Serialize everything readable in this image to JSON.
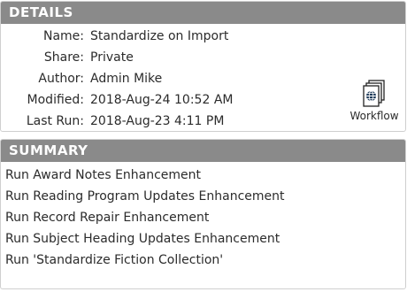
{
  "details": {
    "title": "DETAILS",
    "fields": [
      {
        "label": "Name:",
        "value": "Standardize on Import"
      },
      {
        "label": "Share:",
        "value": "Private"
      },
      {
        "label": "Author:",
        "value": "Admin Mike"
      },
      {
        "label": "Modified:",
        "value": "2018-Aug-24 10:52 AM"
      },
      {
        "label": "Last Run:",
        "value": "2018-Aug-23 4:11 PM"
      }
    ],
    "workflow": {
      "label": "Workflow",
      "icon": "workflow-documents-globe-icon"
    }
  },
  "summary": {
    "title": "SUMMARY",
    "items": [
      "Run Award Notes Enhancement",
      "Run Reading Program Updates Enhancement",
      "Run Record Repair Enhancement",
      "Run Subject Heading Updates Enhancement",
      "Run 'Standardize Fiction Collection'"
    ]
  },
  "colors": {
    "header_bg": "#8a8a8a",
    "header_text": "#ffffff",
    "panel_border": "#cfcfcf"
  }
}
